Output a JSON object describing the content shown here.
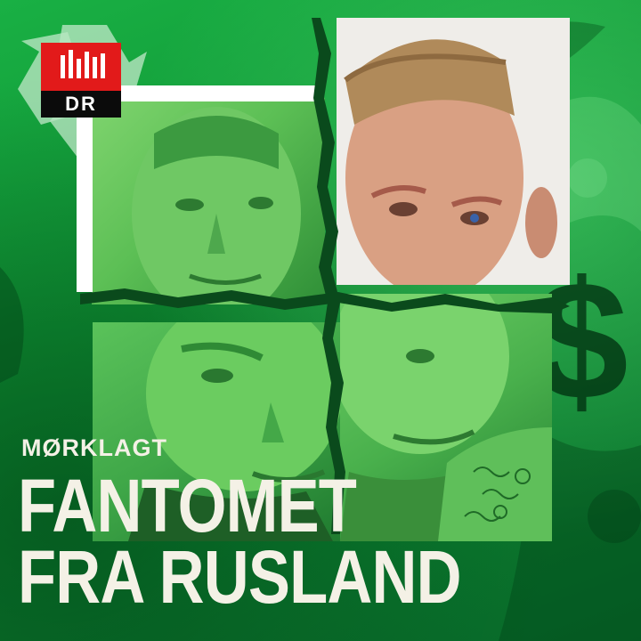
{
  "logo": {
    "text": "DR"
  },
  "series": "MØRKLAGT",
  "title": {
    "line1": "FANTOMET",
    "line2": "FRA RUSLAND"
  },
  "colors": {
    "background": "#0e8f32",
    "text": "#f4f1e6",
    "logo_red": "#e21a1a",
    "logo_black": "#0b0b0b",
    "frame": "#ffffff"
  },
  "icons": [
    "recycle-icon",
    "dollar-sign-icon",
    "dr-logo"
  ]
}
